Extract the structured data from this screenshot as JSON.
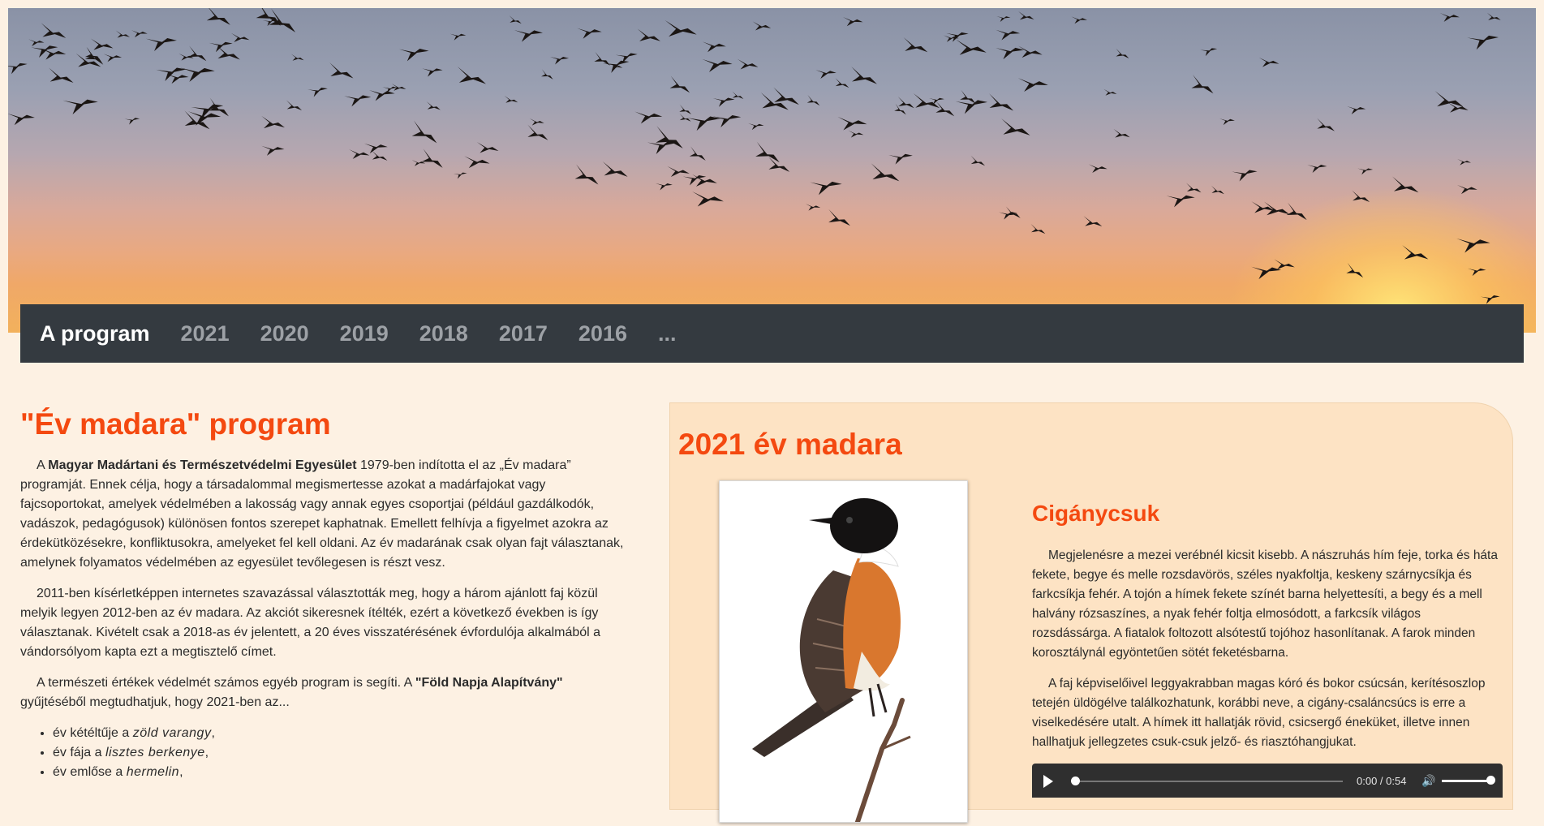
{
  "nav": {
    "items": [
      "A program",
      "2021",
      "2020",
      "2019",
      "2018",
      "2017",
      "2016",
      "..."
    ]
  },
  "left": {
    "title": "\"Év madara\" program",
    "p1_pre": "A ",
    "p1_bold": "Magyar Madártani és Természetvédelmi Egyesület",
    "p1_post": " 1979-ben indította el az „Év madara” programját. Ennek célja, hogy a társadalommal megismertesse azokat a madárfajokat vagy fajcsoportokat, amelyek védelmében a lakosság vagy annak egyes csoportjai (például gazdálkodók, vadászok, pedagógusok) különösen fontos szerepet kaphatnak. Emellett felhívja a figyelmet azokra az érdekütközésekre, konfliktusokra, amelyeket fel kell oldani. Az év madarának csak olyan fajt választanak, amelynek folyamatos védelmében az egyesület tevőlegesen is részt vesz.",
    "p2": "2011-ben kísérletképpen internetes szavazással választották meg, hogy a három ajánlott faj közül melyik legyen 2012-ben az év madara. Az akciót sikeresnek ítélték, ezért a következő években is így választanak. Kivételt csak a 2018-as év jelentett, a 20 éves visszatérésének évfordulója alkalmából a vándorsólyom kapta ezt a megtisztelő címet.",
    "p3_pre": "A természeti értékek védelmét számos egyéb program is segíti. A ",
    "p3_bold": "\"Föld Napja Alapítvány\"",
    "p3_post": " gyűjtéséből megtudhatjuk, hogy 2021-ben az...",
    "list": [
      {
        "pre": "év kétéltűje a ",
        "em": "zöld varangy",
        "post": ","
      },
      {
        "pre": "év fája a ",
        "em": "lisztes berkenye",
        "post": ","
      },
      {
        "pre": "év emlőse a ",
        "em": "hermelin",
        "post": ","
      }
    ]
  },
  "right": {
    "heading": "2021 év madara",
    "species": "Cigánycsuk",
    "p1": "Megjelenésre a mezei verébnél kicsit kisebb. A nászruhás hím feje, torka és háta fekete, begye és melle rozsdavörös, széles nyakfoltja, keskeny szárnycsíkja és farkcsíkja fehér. A tojón a hímek fekete színét barna helyettesíti, a begy és a mell halvány rózsaszínes, a nyak fehér foltja elmosódott, a farkcsík világos rozsdássárga. A fiatalok foltozott alsótestű tojóhoz hasonlítanak. A farok minden korosztálynál egyöntetűen sötét feketésbarna.",
    "p2": "A faj képviselőivel leggyakrabban magas kóró és bokor csúcsán, kerítésoszlop tetején üldögélve találkozhatunk, korábbi neve, a cigány-csaláncsúcs is erre a viselkedésére utalt. A hímek itt hallatják rövid, csicsergő éneküket, illetve innen hallhatjuk jellegzetes csuk-csuk jelző- és riasztóhangjukat.",
    "audio": {
      "time": "0:00 / 0:54"
    }
  },
  "colors": {
    "accent": "#f44910",
    "navbar": "#343a40",
    "page": "#fdf1e3",
    "panel": "#fde3c4"
  }
}
